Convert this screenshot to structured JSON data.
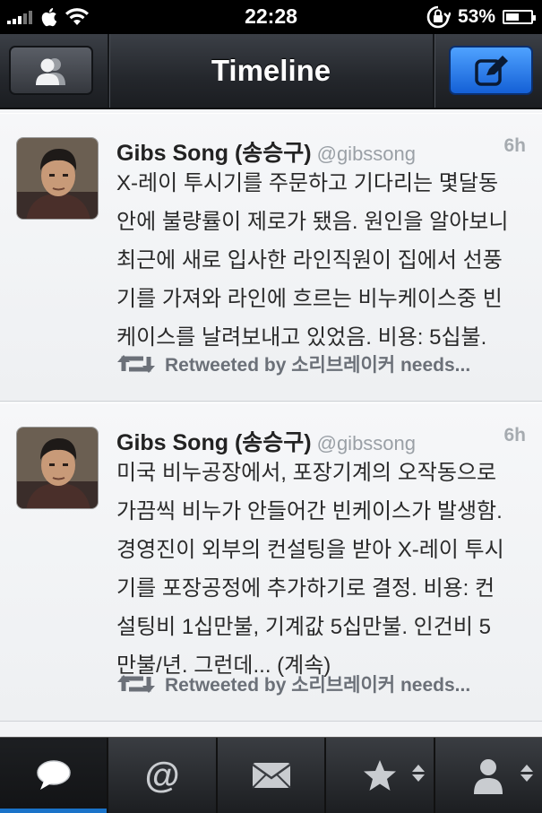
{
  "status_bar": {
    "carrier": "Apple",
    "time": "22:28",
    "battery": "53%"
  },
  "nav": {
    "title": "Timeline"
  },
  "tweets": [
    {
      "name": "Gibs Song (송승구)",
      "handle": "@gibssong",
      "time": "6h",
      "lines": [
        "X-레이 투시기를 주문하고 기다리는 몇달동",
        "안에 불량률이 제로가 됐음. 원인을 알아보니",
        "최근에 새로 입사한 라인직원이 집에서 선풍",
        "기를 가져와 라인에 흐르는 비누케이스중 빈",
        "케이스를 날려보내고 있었음.  비용: 5십불."
      ],
      "retweet": "Retweeted by 소리브레이커 needs..."
    },
    {
      "name": "Gibs Song (송승구)",
      "handle": "@gibssong",
      "time": "6h",
      "lines": [
        "미국 비누공장에서, 포장기계의 오작동으로",
        "가끔씩 비누가 안들어간 빈케이스가 발생함.",
        "경영진이 외부의 컨설팅을 받아 X-레이 투시",
        "기를 포장공정에 추가하기로 결정. 비용: 컨",
        "설팅비 1십만불, 기계값 5십만불. 인건비 5",
        "만불/년. 그런데... (계속)"
      ],
      "retweet": "Retweeted by 소리브레이커 needs..."
    }
  ],
  "tabs": [
    {
      "name": "timeline",
      "icon": "speech-bubble-icon",
      "active": true
    },
    {
      "name": "mentions",
      "icon": "at-icon",
      "active": false
    },
    {
      "name": "messages",
      "icon": "envelope-icon",
      "active": false
    },
    {
      "name": "favorites",
      "icon": "star-icon",
      "active": false
    },
    {
      "name": "profile",
      "icon": "person-icon",
      "active": false
    }
  ],
  "colors": {
    "accent": "#1a73c9",
    "compose_button": "#2a7ef0",
    "tweet_bg": "#f3f4f6"
  }
}
